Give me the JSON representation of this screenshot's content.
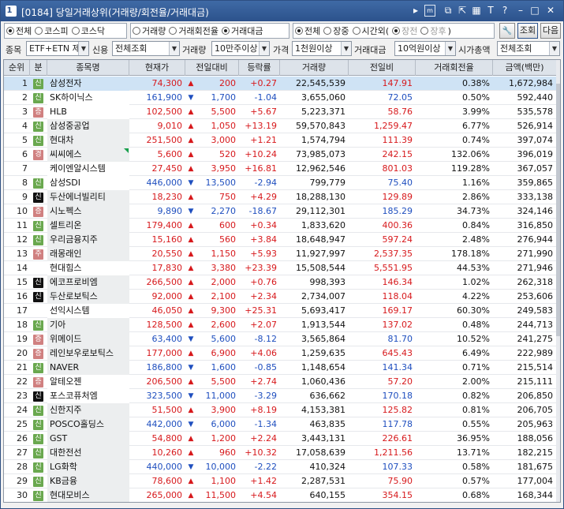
{
  "window": {
    "number": "1",
    "title": "[0184] 당일거래상위(거래량/회전율/거래대금)",
    "tb_icons": [
      "play-right-icon",
      "m-box-icon",
      "copy-icon",
      "share-icon",
      "layout-icon",
      "text-size-icon",
      "help-icon",
      "minimize-icon",
      "maximize-icon",
      "close-icon"
    ]
  },
  "filters": {
    "market": {
      "options": [
        "전체",
        "코스피",
        "코스닥"
      ],
      "selected": 0
    },
    "sort_by": {
      "options": [
        "거래량",
        "거래회전율",
        "거래대금"
      ],
      "selected": 2
    },
    "session": {
      "options": [
        "전체",
        "장중",
        "시간외("
      ],
      "selected": 0
    },
    "sub_session": {
      "options": [
        "장전",
        "장후"
      ],
      "close": ")"
    },
    "settings_label": "🔧",
    "query_label": "조회",
    "next_label": "다음"
  },
  "row2": {
    "item_label": "종목",
    "item_value": "ETF+ETN 제",
    "credit_label": "신용",
    "credit_value": "전체조회",
    "volume_label": "거래량",
    "volume_value": "10만주이상",
    "price_label": "가격",
    "price_value": "1천원이상",
    "amount_label": "거래대금",
    "amount_value": "10억원이상",
    "mcap_label": "시가총액",
    "mcap_value": "전체조회"
  },
  "columns": [
    "순위",
    "분",
    "종목명",
    "현재가",
    "전일대비",
    "등락률",
    "거래량",
    "전일비",
    "거래회전율",
    "금액(백만)"
  ],
  "rows": [
    {
      "rank": "1",
      "badge": "신",
      "bc": "gr",
      "name": "삼성전자",
      "price": "74,300",
      "dir": "up",
      "chg": "200",
      "rate": "+0.27",
      "vol": "22,545,539",
      "prev": "147.91",
      "turn": "0.38%",
      "amt": "1,672,984"
    },
    {
      "rank": "2",
      "badge": "신",
      "bc": "gr",
      "name": "SK하이닉스",
      "price": "161,900",
      "dir": "dn",
      "chg": "1,700",
      "rate": "-1.04",
      "vol": "3,655,060",
      "prev": "72.05",
      "turn": "0.50%",
      "amt": "592,440"
    },
    {
      "rank": "3",
      "badge": "증",
      "bc": "pk",
      "name": "HLB",
      "price": "102,500",
      "dir": "up",
      "chg": "5,500",
      "rate": "+5.67",
      "vol": "5,223,371",
      "prev": "58.76",
      "turn": "3.99%",
      "amt": "535,578"
    },
    {
      "rank": "4",
      "badge": "신",
      "bc": "gr",
      "name": "삼성중공업",
      "price": "9,010",
      "dir": "up",
      "chg": "1,050",
      "rate": "+13.19",
      "vol": "59,570,843",
      "prev": "1,259.47",
      "turn": "6.77%",
      "amt": "526,914"
    },
    {
      "rank": "5",
      "badge": "신",
      "bc": "gr",
      "name": "현대차",
      "price": "251,500",
      "dir": "up",
      "chg": "3,000",
      "rate": "+1.21",
      "vol": "1,574,794",
      "prev": "111.39",
      "turn": "0.74%",
      "amt": "397,074"
    },
    {
      "rank": "6",
      "badge": "경",
      "bc": "pk",
      "name": "씨씨에스",
      "price": "5,600",
      "dir": "up",
      "chg": "520",
      "rate": "+10.24",
      "vol": "73,985,073",
      "prev": "242.15",
      "turn": "132.06%",
      "amt": "396,019"
    },
    {
      "rank": "7",
      "badge": "",
      "bc": "",
      "name": "케이엔알시스템",
      "price": "27,450",
      "dir": "up",
      "chg": "3,950",
      "rate": "+16.81",
      "vol": "12,962,546",
      "prev": "801.03",
      "turn": "119.28%",
      "amt": "367,057"
    },
    {
      "rank": "8",
      "badge": "신",
      "bc": "gr",
      "name": "삼성SDI",
      "price": "446,000",
      "dir": "dn",
      "chg": "13,500",
      "rate": "-2.94",
      "vol": "799,779",
      "prev": "75.40",
      "turn": "1.16%",
      "amt": "359,865"
    },
    {
      "rank": "9",
      "badge": "신",
      "bc": "bk",
      "name": "두산에너빌리티",
      "price": "18,230",
      "dir": "up",
      "chg": "750",
      "rate": "+4.29",
      "vol": "18,288,130",
      "prev": "129.89",
      "turn": "2.86%",
      "amt": "333,138"
    },
    {
      "rank": "10",
      "badge": "증",
      "bc": "pk",
      "name": "시노펙스",
      "price": "9,890",
      "dir": "dn",
      "chg": "2,270",
      "rate": "-18.67",
      "vol": "29,112,301",
      "prev": "185.29",
      "turn": "34.73%",
      "amt": "324,146"
    },
    {
      "rank": "11",
      "badge": "신",
      "bc": "gr",
      "name": "셀트리온",
      "price": "179,400",
      "dir": "up",
      "chg": "600",
      "rate": "+0.34",
      "vol": "1,833,620",
      "prev": "400.36",
      "turn": "0.84%",
      "amt": "316,850"
    },
    {
      "rank": "12",
      "badge": "신",
      "bc": "gr",
      "name": "우리금융지주",
      "price": "15,160",
      "dir": "up",
      "chg": "560",
      "rate": "+3.84",
      "vol": "18,648,947",
      "prev": "597.24",
      "turn": "2.48%",
      "amt": "276,944"
    },
    {
      "rank": "13",
      "badge": "주",
      "bc": "pk",
      "name": "래몽래인",
      "price": "20,550",
      "dir": "up",
      "chg": "1,150",
      "rate": "+5.93",
      "vol": "11,927,997",
      "prev": "2,537.35",
      "turn": "178.18%",
      "amt": "271,990"
    },
    {
      "rank": "14",
      "badge": "",
      "bc": "",
      "name": "현대힘스",
      "price": "17,830",
      "dir": "up",
      "chg": "3,380",
      "rate": "+23.39",
      "vol": "15,508,544",
      "prev": "5,551.95",
      "turn": "44.53%",
      "amt": "271,946"
    },
    {
      "rank": "15",
      "badge": "신",
      "bc": "bk",
      "name": "에코프로비엠",
      "price": "266,500",
      "dir": "up",
      "chg": "2,000",
      "rate": "+0.76",
      "vol": "998,393",
      "prev": "146.34",
      "turn": "1.02%",
      "amt": "262,318"
    },
    {
      "rank": "16",
      "badge": "신",
      "bc": "bk",
      "name": "두산로보틱스",
      "price": "92,000",
      "dir": "up",
      "chg": "2,100",
      "rate": "+2.34",
      "vol": "2,734,007",
      "prev": "118.04",
      "turn": "4.22%",
      "amt": "253,606"
    },
    {
      "rank": "17",
      "badge": "",
      "bc": "",
      "name": "선익시스템",
      "price": "46,050",
      "dir": "up",
      "chg": "9,300",
      "rate": "+25.31",
      "vol": "5,693,417",
      "prev": "169.17",
      "turn": "60.30%",
      "amt": "249,583"
    },
    {
      "rank": "18",
      "badge": "신",
      "bc": "gr",
      "name": "기아",
      "price": "128,500",
      "dir": "up",
      "chg": "2,600",
      "rate": "+2.07",
      "vol": "1,913,544",
      "prev": "137.02",
      "turn": "0.48%",
      "amt": "244,713"
    },
    {
      "rank": "19",
      "badge": "증",
      "bc": "pk",
      "name": "위메이드",
      "price": "63,400",
      "dir": "dn",
      "chg": "5,600",
      "rate": "-8.12",
      "vol": "3,565,864",
      "prev": "81.70",
      "turn": "10.52%",
      "amt": "241,275"
    },
    {
      "rank": "20",
      "badge": "증",
      "bc": "pk",
      "name": "레인보우로보틱스",
      "price": "177,000",
      "dir": "up",
      "chg": "6,900",
      "rate": "+4.06",
      "vol": "1,259,635",
      "prev": "645.43",
      "turn": "6.49%",
      "amt": "222,989"
    },
    {
      "rank": "21",
      "badge": "신",
      "bc": "gr",
      "name": "NAVER",
      "price": "186,800",
      "dir": "dn",
      "chg": "1,600",
      "rate": "-0.85",
      "vol": "1,148,654",
      "prev": "141.34",
      "turn": "0.71%",
      "amt": "215,514"
    },
    {
      "rank": "22",
      "badge": "증",
      "bc": "pk",
      "name": "알테오젠",
      "price": "206,500",
      "dir": "up",
      "chg": "5,500",
      "rate": "+2.74",
      "vol": "1,060,436",
      "prev": "57.20",
      "turn": "2.00%",
      "amt": "215,111"
    },
    {
      "rank": "23",
      "badge": "신",
      "bc": "bk",
      "name": "포스코퓨처엠",
      "price": "323,500",
      "dir": "dn",
      "chg": "11,000",
      "rate": "-3.29",
      "vol": "636,662",
      "prev": "170.18",
      "turn": "0.82%",
      "amt": "206,850"
    },
    {
      "rank": "24",
      "badge": "신",
      "bc": "gr",
      "name": "신한지주",
      "price": "51,500",
      "dir": "up",
      "chg": "3,900",
      "rate": "+8.19",
      "vol": "4,153,381",
      "prev": "125.82",
      "turn": "0.81%",
      "amt": "206,705"
    },
    {
      "rank": "25",
      "badge": "신",
      "bc": "gr",
      "name": "POSCO홀딩스",
      "price": "442,000",
      "dir": "dn",
      "chg": "6,000",
      "rate": "-1.34",
      "vol": "463,835",
      "prev": "117.78",
      "turn": "0.55%",
      "amt": "205,963"
    },
    {
      "rank": "26",
      "badge": "신",
      "bc": "gr",
      "name": "GST",
      "price": "54,800",
      "dir": "up",
      "chg": "1,200",
      "rate": "+2.24",
      "vol": "3,443,131",
      "prev": "226.61",
      "turn": "36.95%",
      "amt": "188,056"
    },
    {
      "rank": "27",
      "badge": "신",
      "bc": "gr",
      "name": "대한전선",
      "price": "10,260",
      "dir": "up",
      "chg": "960",
      "rate": "+10.32",
      "vol": "17,058,639",
      "prev": "1,211.56",
      "turn": "13.71%",
      "amt": "182,215"
    },
    {
      "rank": "28",
      "badge": "신",
      "bc": "gr",
      "name": "LG화학",
      "price": "440,000",
      "dir": "dn",
      "chg": "10,000",
      "rate": "-2.22",
      "vol": "410,324",
      "prev": "107.33",
      "turn": "0.58%",
      "amt": "181,675"
    },
    {
      "rank": "29",
      "badge": "신",
      "bc": "gr",
      "name": "KB금융",
      "price": "78,600",
      "dir": "up",
      "chg": "1,100",
      "rate": "+1.42",
      "vol": "2,287,531",
      "prev": "75.90",
      "turn": "0.57%",
      "amt": "177,004"
    },
    {
      "rank": "30",
      "badge": "신",
      "bc": "gr",
      "name": "현대모비스",
      "price": "265,000",
      "dir": "up",
      "chg": "11,500",
      "rate": "+4.54",
      "vol": "640,155",
      "prev": "354.15",
      "turn": "0.68%",
      "amt": "168,344"
    }
  ],
  "colors": {
    "up": "#d7191c",
    "down": "#1f4fbf",
    "title_bar": "#2c528c",
    "selected_row": "#cfe3f5"
  }
}
